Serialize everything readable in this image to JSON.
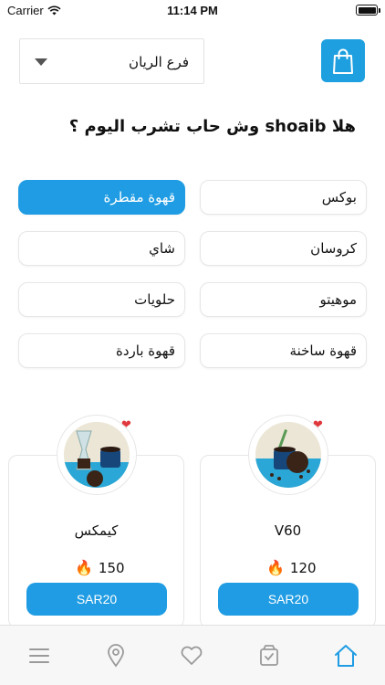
{
  "status_bar": {
    "carrier": "Carrier",
    "time": "11:14 PM"
  },
  "header": {
    "branch": "فرع الريان"
  },
  "greeting": "هلا shoaib وش حاب تشرب اليوم ؟",
  "categories": [
    {
      "label": "بوكس",
      "active": false
    },
    {
      "label": "قهوة مقطرة",
      "active": true
    },
    {
      "label": "كروسان",
      "active": false
    },
    {
      "label": "شاي",
      "active": false
    },
    {
      "label": "موهيتو",
      "active": false
    },
    {
      "label": "حلويات",
      "active": false
    },
    {
      "label": "قهوة ساخنة",
      "active": false
    },
    {
      "label": "قهوة باردة",
      "active": false
    }
  ],
  "products": [
    {
      "name": "V60",
      "calories": "120",
      "price": "SAR20",
      "favorite": true
    },
    {
      "name": "كيمكس",
      "calories": "150",
      "price": "SAR20",
      "favorite": true
    }
  ],
  "tabbar": {
    "items": [
      {
        "icon": "menu-icon",
        "active": false
      },
      {
        "icon": "location-icon",
        "active": false
      },
      {
        "icon": "heart-icon",
        "active": false
      },
      {
        "icon": "orders-icon",
        "active": false
      },
      {
        "icon": "home-icon",
        "active": true
      }
    ]
  },
  "colors": {
    "accent": "#1f9ce3",
    "heart": "#e0383c",
    "fire": "#f06522"
  }
}
